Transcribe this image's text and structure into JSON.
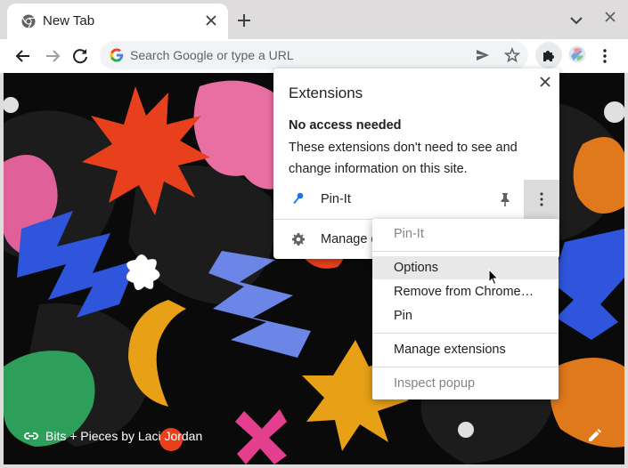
{
  "browser": {
    "tab": {
      "title": "New Tab",
      "favicon": "chrome-icon",
      "close_icon": "close-icon"
    },
    "new_tab_icon": "plus-icon",
    "tab_search_icon": "chevron-down-icon",
    "window_close_icon": "close-icon"
  },
  "toolbar": {
    "back_icon": "back-arrow-icon",
    "forward_icon": "forward-arrow-icon",
    "reload_icon": "reload-icon",
    "omnibox": {
      "placeholder": "Search Google or type a URL",
      "engine_icon": "google-g-icon"
    },
    "send_icon": "send-icon",
    "bookmark_icon": "star-icon",
    "extensions_icon": "puzzle-icon",
    "menu_icon": "kebab-icon"
  },
  "background": {
    "attribution": "Bits + Pieces by Laci Jordan",
    "link_icon": "link-icon",
    "edit_icon": "pencil-icon"
  },
  "extensions_popup": {
    "title": "Extensions",
    "section_heading": "No access needed",
    "section_description": "These extensions don't need to see and change information on this site.",
    "extensions": [
      {
        "name": "Pin-It",
        "icon": "pin-it-icon",
        "pin_icon": "pin-icon",
        "more_icon": "kebab-icon"
      }
    ],
    "manage_label": "Manage extensions",
    "manage_icon": "gear-icon"
  },
  "context_menu": {
    "header": "Pin-It",
    "items": [
      "Options",
      "Remove from Chrome…",
      "Pin"
    ],
    "manage": "Manage extensions",
    "inspect": "Inspect popup"
  },
  "colors": {
    "titlebar": "#dedcdc",
    "active_tab": "#ffffff",
    "omnibox": "#f1f3f4",
    "wallpaper": "#0a0a0a",
    "text_primary": "#202124",
    "text_disabled": "#80868b"
  }
}
